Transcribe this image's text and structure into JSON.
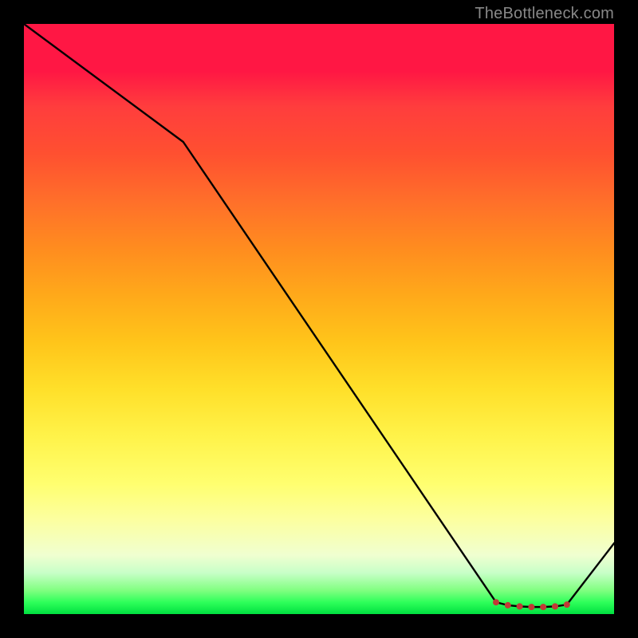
{
  "attribution": "TheBottleneck.com",
  "chart_data": {
    "type": "line",
    "title": "",
    "xlabel": "",
    "ylabel": "",
    "ylim": [
      0,
      100
    ],
    "xlim": [
      0,
      100
    ],
    "x": [
      0,
      27,
      80,
      82,
      84,
      86,
      88,
      90,
      92,
      100
    ],
    "values": [
      100,
      80,
      2,
      1.5,
      1.3,
      1.2,
      1.2,
      1.3,
      1.6,
      12
    ],
    "markers": {
      "x": [
        80,
        82,
        84,
        86,
        88,
        90,
        92
      ],
      "values": [
        2.0,
        1.5,
        1.3,
        1.2,
        1.2,
        1.3,
        1.6
      ],
      "color": "#c23a36"
    },
    "gradient_stops": [
      {
        "pos": 0,
        "color": "#ff1744"
      },
      {
        "pos": 50,
        "color": "#ffc51a"
      },
      {
        "pos": 80,
        "color": "#ffff70"
      },
      {
        "pos": 100,
        "color": "#00e040"
      }
    ]
  }
}
